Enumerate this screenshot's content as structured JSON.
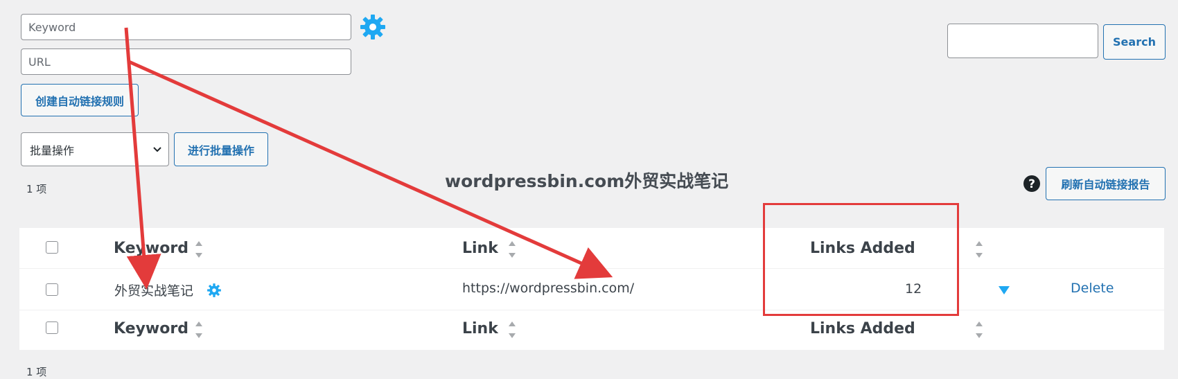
{
  "form": {
    "keyword_placeholder": "Keyword",
    "url_placeholder": "URL",
    "create_button": "创建自动链接规则"
  },
  "search": {
    "value": "",
    "button": "Search"
  },
  "bulk": {
    "select_value": "批量操作",
    "apply_button": "进行批量操作"
  },
  "items_count_top": "1 项",
  "items_count_bottom": "1 项",
  "refresh_button": "刷新自动链接报告",
  "help_icon": "question-circle-icon",
  "watermark": "wordpressbin.com外贸实战笔记",
  "table": {
    "columns": {
      "keyword": "Keyword",
      "link": "Link",
      "links_added": "Links Added"
    },
    "rows": [
      {
        "keyword": "外贸实战笔记",
        "link": "https://wordpressbin.com/",
        "links_added": "12",
        "delete": "Delete"
      }
    ]
  },
  "colors": {
    "accent": "#2271b1",
    "gear": "#1fa8f2",
    "annotation": "#e33b3b"
  }
}
